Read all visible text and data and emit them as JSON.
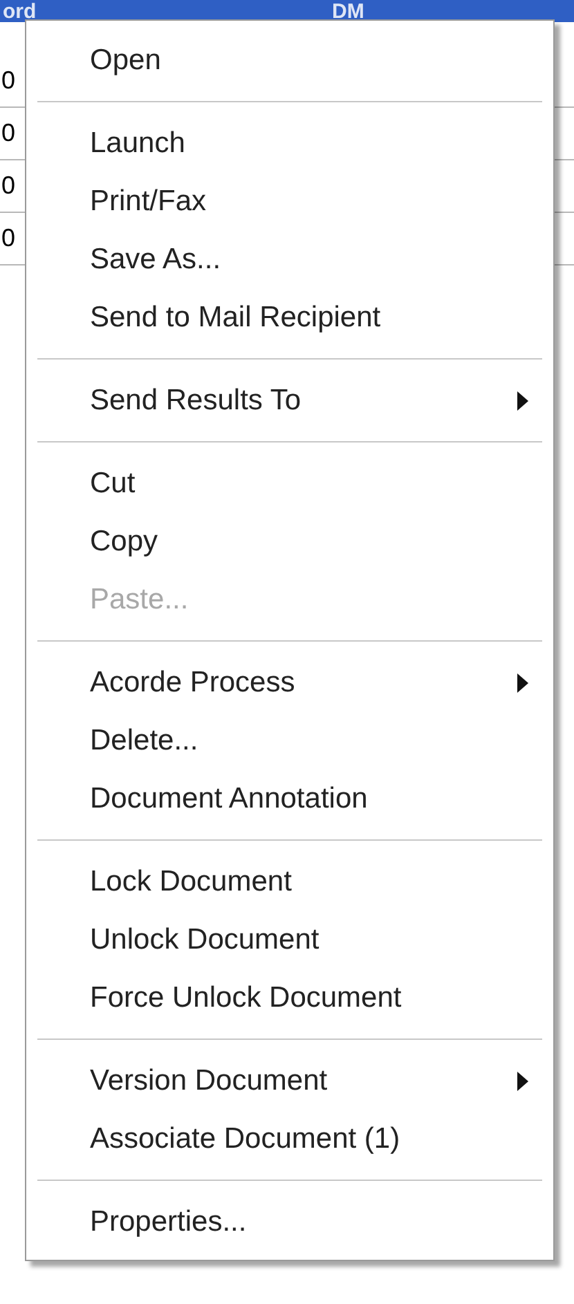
{
  "background_table": {
    "header": [
      "ord",
      "DM"
    ],
    "rows": [
      {
        "column_1": "0"
      },
      {
        "column_1": "0"
      },
      {
        "column_1": "0"
      },
      {
        "column_1": "0"
      }
    ]
  },
  "context_menu": {
    "groups": [
      {
        "items": [
          {
            "label": "Open",
            "disabled": false,
            "submenu": false
          }
        ]
      },
      {
        "items": [
          {
            "label": "Launch",
            "disabled": false,
            "submenu": false
          },
          {
            "label": "Print/Fax",
            "disabled": false,
            "submenu": false
          },
          {
            "label": "Save As...",
            "disabled": false,
            "submenu": false
          },
          {
            "label": "Send to Mail Recipient",
            "disabled": false,
            "submenu": false
          }
        ]
      },
      {
        "items": [
          {
            "label": "Send Results To",
            "disabled": false,
            "submenu": true
          }
        ]
      },
      {
        "items": [
          {
            "label": "Cut",
            "disabled": false,
            "submenu": false
          },
          {
            "label": "Copy",
            "disabled": false,
            "submenu": false
          },
          {
            "label": "Paste...",
            "disabled": true,
            "submenu": false
          }
        ]
      },
      {
        "items": [
          {
            "label": "Acorde Process",
            "disabled": false,
            "submenu": true
          },
          {
            "label": "Delete...",
            "disabled": false,
            "submenu": false
          },
          {
            "label": "Document Annotation",
            "disabled": false,
            "submenu": false
          }
        ]
      },
      {
        "items": [
          {
            "label": "Lock Document",
            "disabled": false,
            "submenu": false
          },
          {
            "label": "Unlock Document",
            "disabled": false,
            "submenu": false
          },
          {
            "label": "Force Unlock Document",
            "disabled": false,
            "submenu": false
          }
        ]
      },
      {
        "items": [
          {
            "label": "Version Document",
            "disabled": false,
            "submenu": true
          },
          {
            "label": "Associate Document (1)",
            "disabled": false,
            "submenu": false
          }
        ]
      },
      {
        "items": [
          {
            "label": "Properties...",
            "disabled": false,
            "submenu": false
          }
        ]
      }
    ]
  }
}
